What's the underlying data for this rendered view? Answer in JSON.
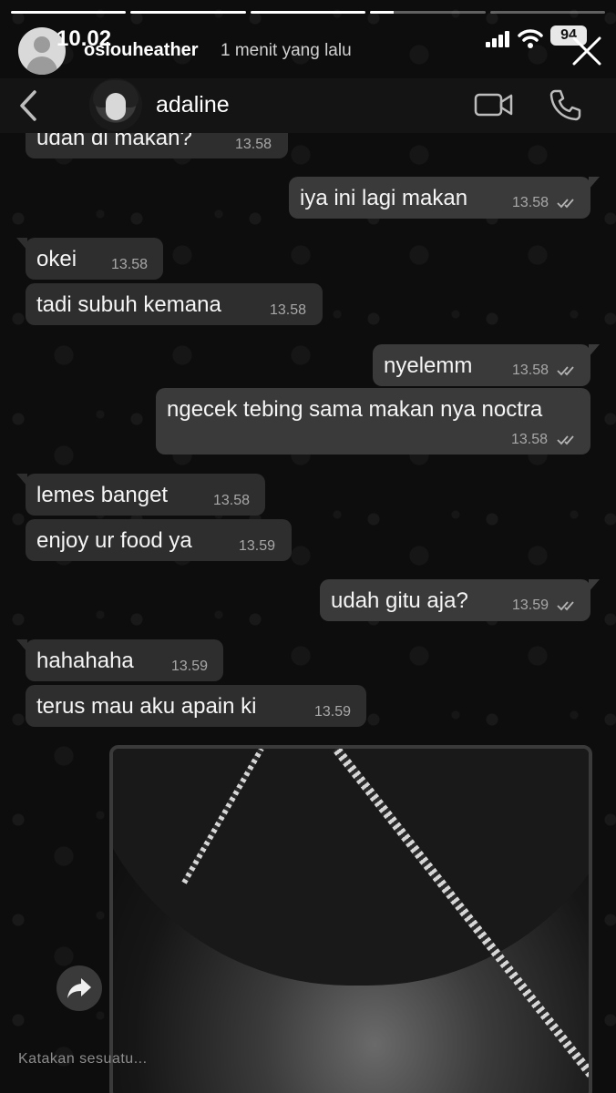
{
  "story": {
    "clock": "10.02",
    "username": "oslouheather",
    "time_ago": "1 menit yang lalu",
    "battery": "94",
    "progress_segments": [
      1,
      1,
      1,
      0.2,
      0
    ]
  },
  "chat": {
    "contact_name": "adaline",
    "messages": [
      {
        "dir": "in",
        "text": "udah di makan?",
        "time": "13.58"
      },
      {
        "dir": "out",
        "text": "iya ini lagi makan",
        "time": "13.58"
      },
      {
        "dir": "in",
        "text": "okei",
        "time": "13.58"
      },
      {
        "dir": "in",
        "text": "tadi subuh kemana",
        "time": "13.58"
      },
      {
        "dir": "out",
        "text": "nyelemm",
        "time": "13.58"
      },
      {
        "dir": "out",
        "text": "ngecek tebing sama makan nya noctra",
        "time": "13.58"
      },
      {
        "dir": "in",
        "text": "lemes banget",
        "time": "13.58"
      },
      {
        "dir": "in",
        "text": "enjoy ur food ya",
        "time": "13.59"
      },
      {
        "dir": "out",
        "text": "udah gitu aja?",
        "time": "13.59"
      },
      {
        "dir": "in",
        "text": "hahahaha",
        "time": "13.59"
      },
      {
        "dir": "in",
        "text": "terus mau aku apain ki",
        "time": "13.59"
      }
    ]
  },
  "reply_placeholder": "Katakan sesuatu..."
}
